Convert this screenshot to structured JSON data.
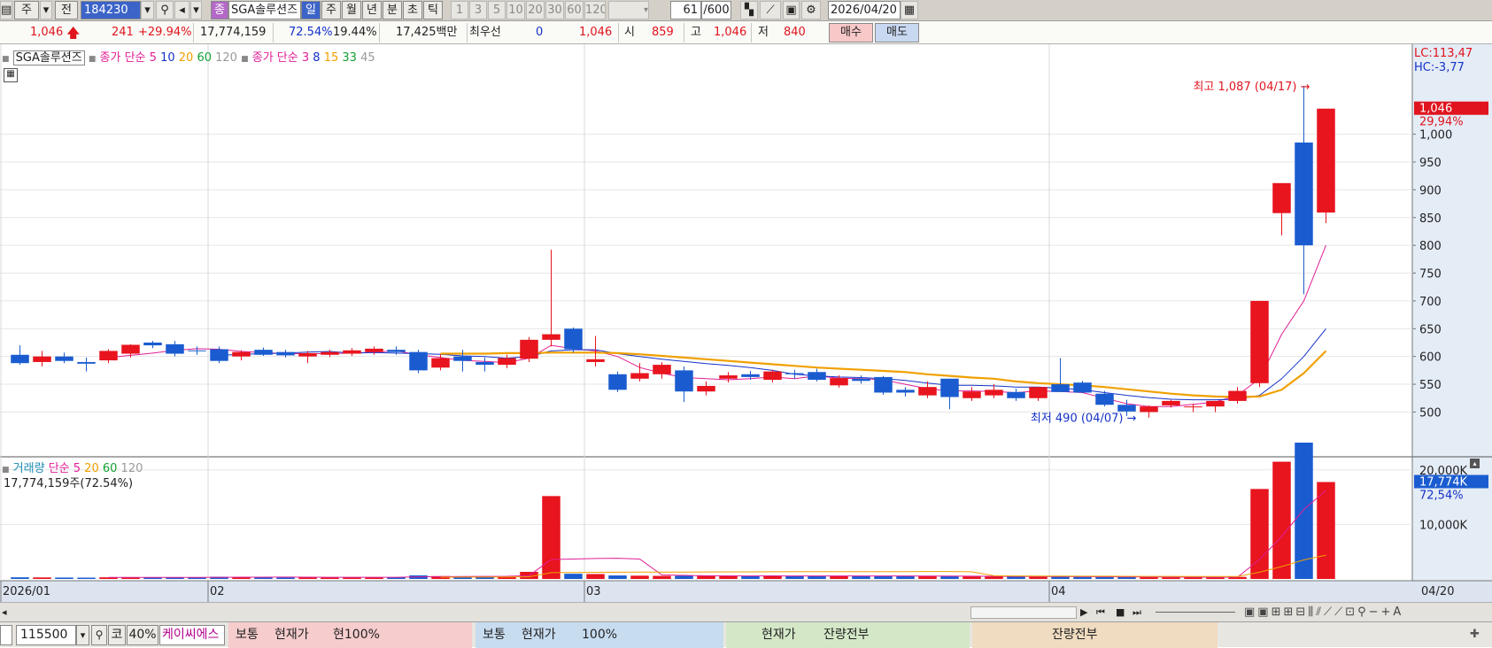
{
  "toolbar": {
    "market_label": "주",
    "prev_label": "전",
    "code": "184230",
    "stock_name": "SGA솔루션즈",
    "name_badge": "종",
    "period_tabs": [
      "일",
      "주",
      "월",
      "년",
      "분",
      "초",
      "틱"
    ],
    "minute_options": [
      "1",
      "3",
      "5",
      "10",
      "20",
      "30",
      "60",
      "120"
    ],
    "count_value": "61",
    "count_total": "/600",
    "date": "2026/04/20"
  },
  "quote": {
    "price": "1,046",
    "change": "241",
    "change_pct": "+29.94%",
    "volume": "17,774,159",
    "volume_ratio": "72.54%",
    "turnover": "19.44%",
    "amount": "17,425백만",
    "priority_label": "최우선",
    "priority_sell": "0",
    "priority_buy": "1,046",
    "open_label": "시",
    "open": "859",
    "high_label": "고",
    "high": "1,046",
    "low_label": "저",
    "low": "840",
    "buy_button": "매수",
    "sell_button": "매도"
  },
  "legends": {
    "price_name": "SGA솔루션즈",
    "ma_label": "종가 단순",
    "ma_periods": [
      "5",
      "10",
      "20",
      "60",
      "120"
    ],
    "ma2_label": "종가 단순",
    "ma2_periods": [
      "3",
      "8",
      "15",
      "33",
      "45"
    ],
    "volume_label": "거래량",
    "vol_ma_label": "단순",
    "vol_ma_periods": [
      "5",
      "20",
      "60",
      "120"
    ],
    "volume_info": "17,774,159주(72.54%)",
    "lc": "LC:113,47",
    "hc": "HC:-3,77"
  },
  "colors": {
    "up": "#e8141e",
    "down": "#1a5cd0",
    "ma5": "#e01e96",
    "ma10": "#1432c8",
    "ma20": "#f0a000",
    "ma60": "#14a032",
    "ma120": "#9a9a9a"
  },
  "chart_data": {
    "type": "candlestick",
    "price_axis": {
      "min": 480,
      "max": 1130,
      "ticks": [
        500,
        550,
        600,
        650,
        700,
        750,
        800,
        850,
        900,
        950,
        1000
      ]
    },
    "volume_axis": {
      "max": 25000,
      "ticks_labels": [
        "10,000K",
        "20,000K"
      ],
      "ticks": [
        10000,
        20000
      ]
    },
    "x_labels": [
      {
        "index": 0,
        "label": "2026/01"
      },
      {
        "index": 9,
        "label": "02"
      },
      {
        "index": 26,
        "label": "03"
      },
      {
        "index": 47,
        "label": "04"
      }
    ],
    "last_date_label": "04/20",
    "annotations": {
      "high": {
        "index": 59,
        "value": 1087,
        "label": "최고 1,087 (04/17)"
      },
      "low": {
        "index": 51,
        "value": 490,
        "label": "최저 490 (04/07)"
      }
    },
    "current": {
      "price_label": "1,046",
      "pct_label": "29,94%",
      "volume_label": "17,774K",
      "volume_pct": "72,54%"
    },
    "candles": [
      {
        "o": 603,
        "h": 620,
        "l": 585,
        "c": 588
      },
      {
        "o": 590,
        "h": 610,
        "l": 582,
        "c": 600
      },
      {
        "o": 600,
        "h": 607,
        "l": 588,
        "c": 592
      },
      {
        "o": 590,
        "h": 598,
        "l": 573,
        "c": 587
      },
      {
        "o": 593,
        "h": 613,
        "l": 588,
        "c": 610
      },
      {
        "o": 605,
        "h": 622,
        "l": 598,
        "c": 621
      },
      {
        "o": 625,
        "h": 628,
        "l": 615,
        "c": 620
      },
      {
        "o": 622,
        "h": 628,
        "l": 600,
        "c": 605
      },
      {
        "o": 611,
        "h": 618,
        "l": 603,
        "c": 610
      },
      {
        "o": 613,
        "h": 618,
        "l": 588,
        "c": 592
      },
      {
        "o": 600,
        "h": 611,
        "l": 593,
        "c": 608
      },
      {
        "o": 612,
        "h": 616,
        "l": 601,
        "c": 603
      },
      {
        "o": 608,
        "h": 612,
        "l": 598,
        "c": 602
      },
      {
        "o": 600,
        "h": 610,
        "l": 588,
        "c": 606
      },
      {
        "o": 603,
        "h": 612,
        "l": 599,
        "c": 608
      },
      {
        "o": 605,
        "h": 615,
        "l": 601,
        "c": 611
      },
      {
        "o": 608,
        "h": 618,
        "l": 603,
        "c": 614
      },
      {
        "o": 612,
        "h": 618,
        "l": 603,
        "c": 608
      },
      {
        "o": 608,
        "h": 612,
        "l": 570,
        "c": 575
      },
      {
        "o": 580,
        "h": 604,
        "l": 575,
        "c": 597
      },
      {
        "o": 600,
        "h": 612,
        "l": 573,
        "c": 592
      },
      {
        "o": 590,
        "h": 598,
        "l": 573,
        "c": 585
      },
      {
        "o": 585,
        "h": 603,
        "l": 579,
        "c": 597
      },
      {
        "o": 596,
        "h": 635,
        "l": 590,
        "c": 630
      },
      {
        "o": 630,
        "h": 792,
        "l": 618,
        "c": 640
      },
      {
        "o": 650,
        "h": 652,
        "l": 607,
        "c": 613
      },
      {
        "o": 590,
        "h": 637,
        "l": 582,
        "c": 595
      },
      {
        "o": 568,
        "h": 573,
        "l": 536,
        "c": 540
      },
      {
        "o": 560,
        "h": 588,
        "l": 555,
        "c": 570
      },
      {
        "o": 568,
        "h": 590,
        "l": 560,
        "c": 585
      },
      {
        "o": 575,
        "h": 582,
        "l": 518,
        "c": 537
      },
      {
        "o": 537,
        "h": 555,
        "l": 530,
        "c": 547
      },
      {
        "o": 560,
        "h": 572,
        "l": 553,
        "c": 566
      },
      {
        "o": 568,
        "h": 574,
        "l": 558,
        "c": 563
      },
      {
        "o": 558,
        "h": 576,
        "l": 553,
        "c": 573
      },
      {
        "o": 570,
        "h": 576,
        "l": 560,
        "c": 568
      },
      {
        "o": 572,
        "h": 578,
        "l": 555,
        "c": 558
      },
      {
        "o": 548,
        "h": 566,
        "l": 544,
        "c": 561
      },
      {
        "o": 560,
        "h": 566,
        "l": 551,
        "c": 556
      },
      {
        "o": 563,
        "h": 565,
        "l": 531,
        "c": 535
      },
      {
        "o": 540,
        "h": 545,
        "l": 528,
        "c": 535
      },
      {
        "o": 530,
        "h": 555,
        "l": 525,
        "c": 545
      },
      {
        "o": 560,
        "h": 560,
        "l": 505,
        "c": 527
      },
      {
        "o": 525,
        "h": 545,
        "l": 520,
        "c": 537
      },
      {
        "o": 530,
        "h": 550,
        "l": 525,
        "c": 540
      },
      {
        "o": 536,
        "h": 542,
        "l": 520,
        "c": 525
      },
      {
        "o": 525,
        "h": 545,
        "l": 520,
        "c": 545
      },
      {
        "o": 550,
        "h": 597,
        "l": 540,
        "c": 536
      },
      {
        "o": 553,
        "h": 556,
        "l": 534,
        "c": 535
      },
      {
        "o": 533,
        "h": 538,
        "l": 510,
        "c": 513
      },
      {
        "o": 513,
        "h": 522,
        "l": 493,
        "c": 501
      },
      {
        "o": 500,
        "h": 512,
        "l": 490,
        "c": 510
      },
      {
        "o": 512,
        "h": 522,
        "l": 508,
        "c": 520
      },
      {
        "o": 510,
        "h": 515,
        "l": 500,
        "c": 510
      },
      {
        "o": 510,
        "h": 520,
        "l": 500,
        "c": 520
      },
      {
        "o": 520,
        "h": 545,
        "l": 515,
        "c": 538
      },
      {
        "o": 552,
        "h": 700,
        "l": 545,
        "c": 700
      },
      {
        "o": 858,
        "h": 912,
        "l": 818,
        "c": 912
      },
      {
        "o": 985,
        "h": 1087,
        "l": 712,
        "c": 800
      },
      {
        "o": 859,
        "h": 1046,
        "l": 840,
        "c": 1046
      }
    ],
    "volume": [
      300,
      280,
      260,
      240,
      300,
      320,
      280,
      260,
      300,
      400,
      350,
      320,
      300,
      280,
      300,
      310,
      320,
      330,
      650,
      520,
      480,
      400,
      420,
      1300,
      15200,
      950,
      900,
      640,
      600,
      560,
      580,
      560,
      540,
      560,
      570,
      540,
      520,
      580,
      560,
      540,
      520,
      500,
      480,
      470,
      460,
      450,
      440,
      400,
      380,
      360,
      340,
      320,
      300,
      310,
      300,
      380,
      16500,
      21500,
      25000,
      17774
    ],
    "series": [
      {
        "name": "5",
        "values": [
          null,
          null,
          null,
          null,
          598,
          602,
          606,
          611,
          614,
          613,
          609,
          607,
          605,
          605,
          605,
          606,
          608,
          610,
          603,
          598,
          593,
          591,
          589,
          597,
          620,
          614,
          610,
          600,
          580,
          570,
          562,
          560,
          558,
          560,
          563,
          560,
          565,
          561,
          560,
          558,
          550,
          542,
          538,
          538,
          537,
          535,
          538,
          537,
          535,
          525,
          515,
          510,
          510,
          514,
          518,
          530,
          560,
          640,
          700,
          800
        ]
      },
      {
        "name": "10",
        "values": [
          null,
          null,
          null,
          null,
          null,
          null,
          null,
          null,
          null,
          602,
          604,
          605,
          606,
          608,
          609,
          606,
          607,
          606,
          605,
          604,
          601,
          600,
          597,
          600,
          610,
          612,
          612,
          605,
          600,
          595,
          591,
          587,
          584,
          580,
          575,
          568,
          565,
          563,
          562,
          560,
          557,
          552,
          548,
          548,
          547,
          545,
          545,
          543,
          540,
          535,
          530,
          526,
          523,
          522,
          522,
          523,
          530,
          560,
          600,
          650
        ]
      },
      {
        "name": "20",
        "values": [
          null,
          null,
          null,
          null,
          null,
          null,
          null,
          null,
          null,
          null,
          null,
          null,
          null,
          null,
          null,
          null,
          null,
          null,
          null,
          605,
          605,
          605,
          606,
          606,
          607,
          607,
          607,
          606,
          604,
          601,
          598,
          595,
          592,
          589,
          586,
          583,
          580,
          578,
          576,
          574,
          572,
          568,
          565,
          562,
          560,
          555,
          552,
          550,
          548,
          545,
          541,
          537,
          533,
          530,
          528,
          527,
          528,
          540,
          570,
          610
        ]
      },
      {
        "name": "60",
        "values": [
          null,
          null,
          null,
          null,
          null,
          null,
          null,
          null,
          null,
          null,
          null,
          null,
          null,
          null,
          null,
          null,
          null,
          null,
          null,
          null,
          null,
          null,
          null,
          null,
          null,
          null,
          null,
          null,
          null,
          null,
          null,
          null,
          null,
          null,
          null,
          null,
          null,
          null,
          null,
          null,
          null,
          null,
          null,
          null,
          null,
          null,
          null,
          null,
          null,
          null,
          null,
          null,
          null,
          null,
          null,
          null,
          null,
          null,
          null,
          null
        ]
      },
      {
        "name": "120",
        "values": [
          null,
          null,
          null,
          null,
          null,
          null,
          null,
          null,
          null,
          null,
          null,
          null,
          null,
          null,
          null,
          null,
          null,
          null,
          null,
          null,
          null,
          null,
          null,
          null,
          null,
          null,
          null,
          null,
          null,
          null,
          null,
          null,
          null,
          null,
          null,
          null,
          null,
          null,
          null,
          null,
          null,
          null,
          null,
          null,
          null,
          null,
          null,
          null,
          null,
          null,
          null,
          null,
          null,
          null,
          null,
          null,
          null,
          null,
          null,
          null
        ]
      }
    ]
  },
  "navbar": {
    "icons": [
      "play-icon",
      "rewind-icon",
      "stop-icon",
      "fast-forward-icon"
    ]
  },
  "orderbar": {
    "qty": "115500",
    "market": "코",
    "rate": "40%",
    "broker": "케이씨에스",
    "buy_type": "보통",
    "buy_price": "현재가",
    "buy_qty": "현100%",
    "sell_type": "보통",
    "sell_price": "현재가",
    "sell_qty": "100%",
    "mod_price": "현재가",
    "mod_qty": "잔량전부",
    "cancel_qty": "잔량전부"
  }
}
